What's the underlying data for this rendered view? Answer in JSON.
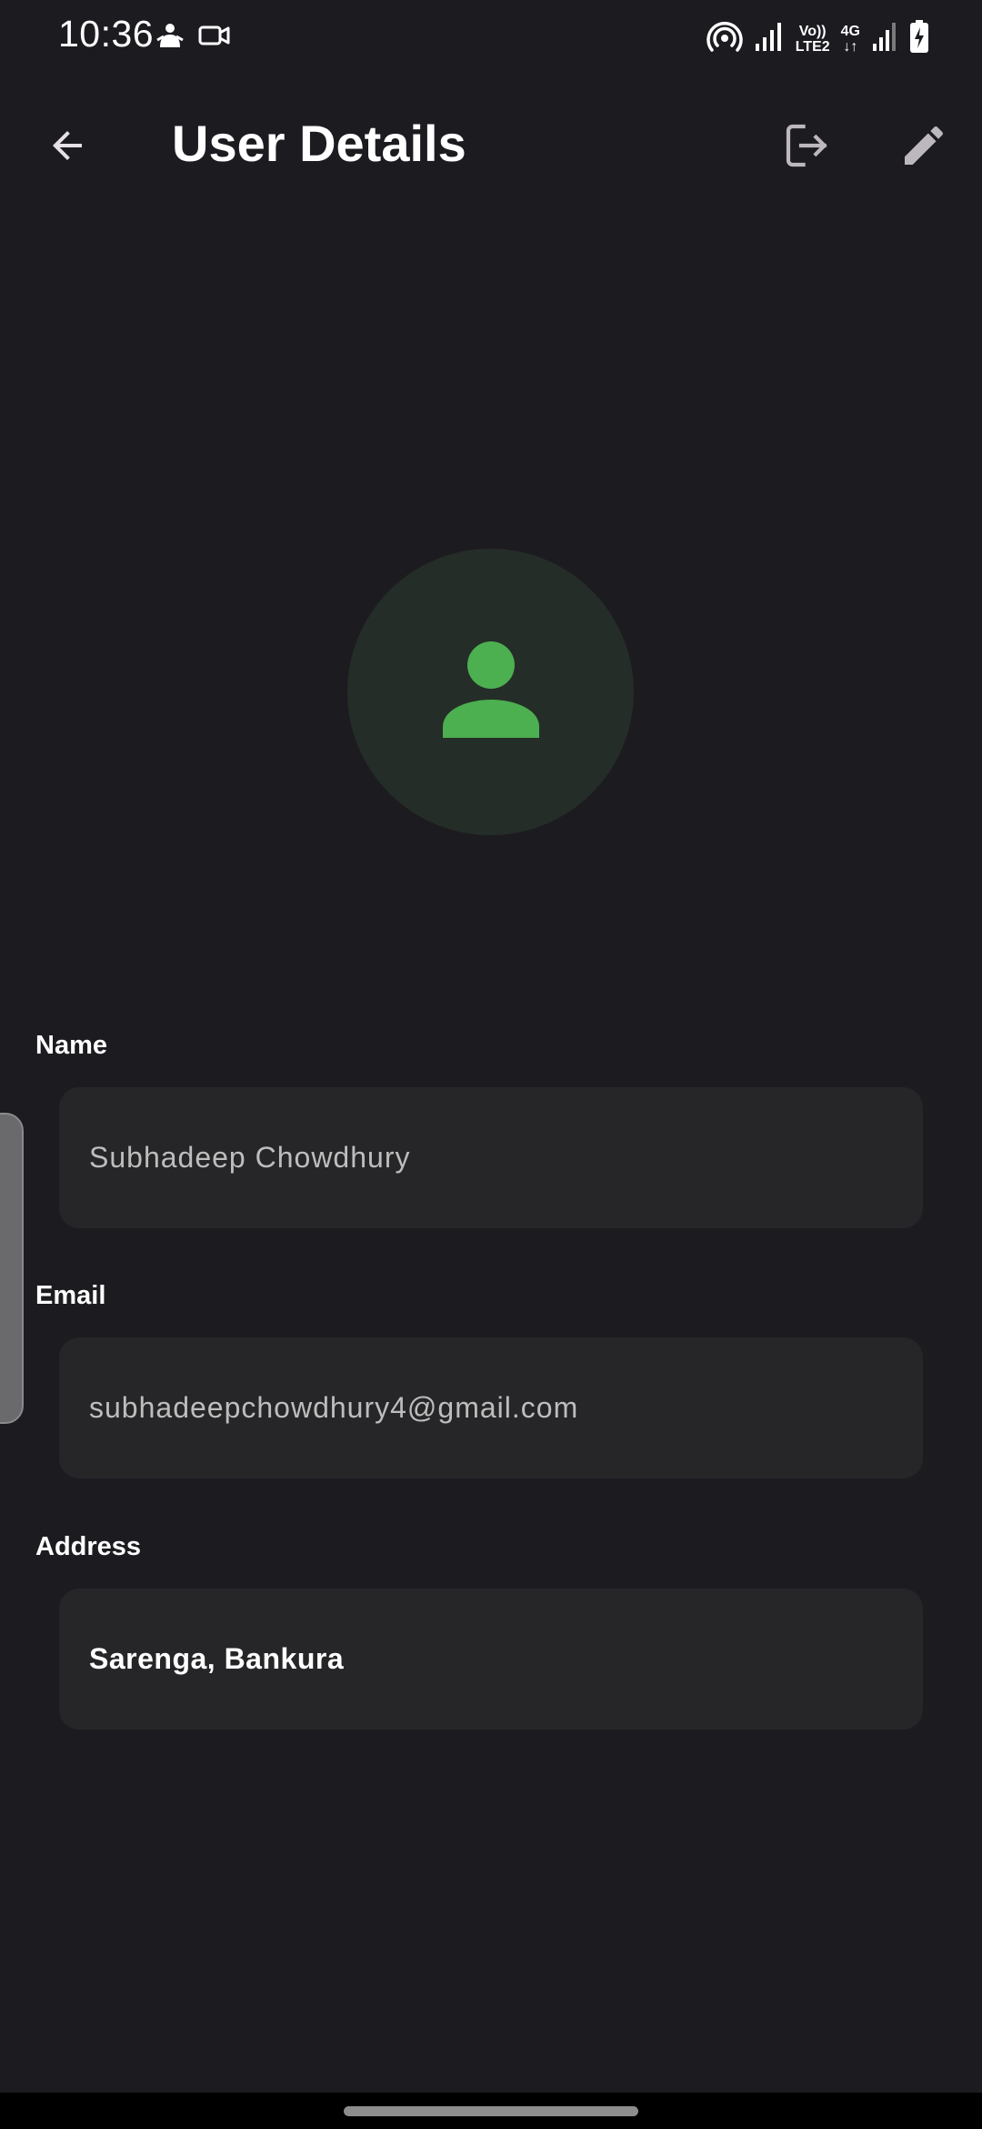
{
  "status_bar": {
    "time": "10:36",
    "network_top": "Vo))",
    "network_bottom": "LTE2",
    "data_type": "4G",
    "data_arrows": "↓↑"
  },
  "app_bar": {
    "title": "User Details",
    "back_icon": "arrow-back-icon",
    "logout_icon": "logout-icon",
    "edit_icon": "edit-pencil-icon"
  },
  "avatar": {
    "icon": "person-icon",
    "icon_color": "#4caf50",
    "bg_color": "#252d28"
  },
  "fields": {
    "name": {
      "label": "Name",
      "value": "Subhadeep Chowdhury",
      "enabled": false
    },
    "email": {
      "label": "Email",
      "value": "subhadeepchowdhury4@gmail.com",
      "enabled": false
    },
    "address": {
      "label": "Address",
      "value": "Sarenga, Bankura",
      "enabled": true
    }
  },
  "colors": {
    "background": "#1c1b20",
    "field_background": "#262628",
    "accent": "#4caf50"
  }
}
